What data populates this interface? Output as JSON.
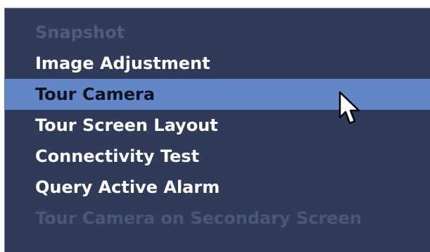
{
  "menu": {
    "items": [
      {
        "label": "Snapshot",
        "state": "disabled"
      },
      {
        "label": "Image Adjustment",
        "state": "enabled"
      },
      {
        "label": "Tour Camera",
        "state": "selected"
      },
      {
        "label": "Tour Screen Layout",
        "state": "enabled"
      },
      {
        "label": "Connectivity Test",
        "state": "enabled"
      },
      {
        "label": "Query Active Alarm",
        "state": "enabled"
      },
      {
        "label": "Tour Camera on Secondary Screen",
        "state": "disabled"
      }
    ]
  },
  "colors": {
    "menu_background": "#2f3b58",
    "selected_background": "#6386c6",
    "enabled_text": "#ffffff",
    "disabled_text": "#4f5d7a",
    "selected_text": "#0f1322"
  },
  "icons": {
    "cursor": "mouse-pointer-arrow"
  }
}
